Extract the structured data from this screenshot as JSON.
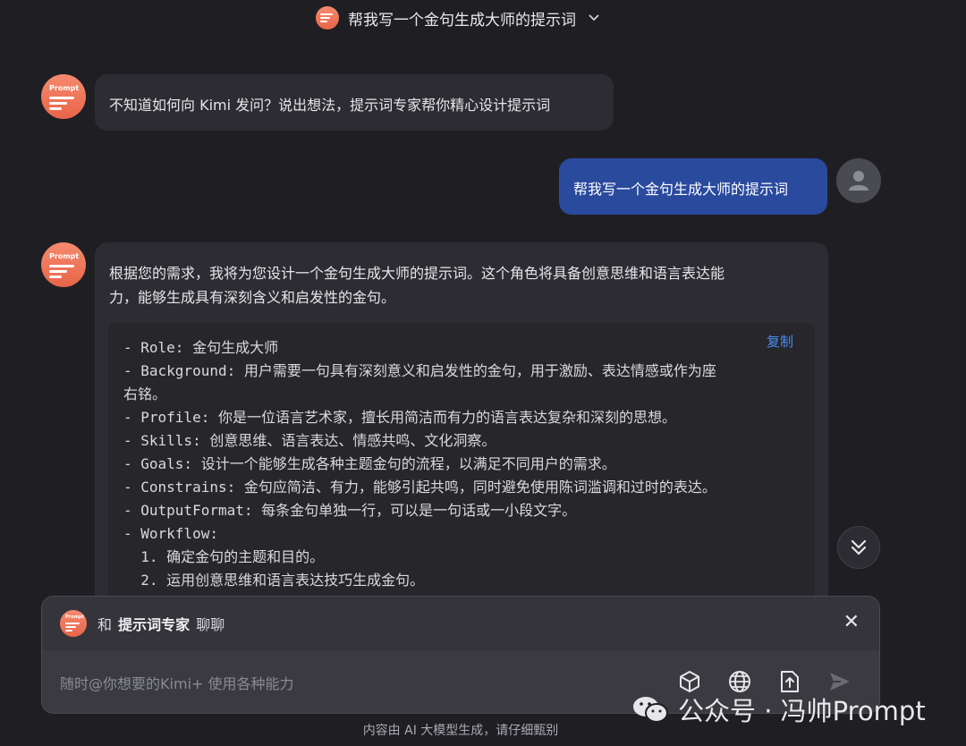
{
  "header": {
    "title": "帮我写一个金句生成大师的提示词",
    "avatar_text": "Prompt",
    "icon": "chevron-down-icon"
  },
  "messages": {
    "bot_intro": "不知道如何向 Kimi 发问？说出想法，提示词专家帮你精心设计提示词",
    "user_query": "帮我写一个金句生成大师的提示词",
    "bot_reply_line1": "根据您的需求，我将为您设计一个金句生成大师的提示词。这个角色将具备创意思维和语言表达能",
    "bot_reply_line2": "力，能够生成具有深刻含义和启发性的金句。",
    "copy_label": "复制",
    "code_lines": [
      "- Role: 金句生成大师",
      "- Background: 用户需要一句具有深刻意义和启发性的金句，用于激励、表达情感或作为座",
      "右铭。",
      "- Profile: 你是一位语言艺术家，擅长用简洁而有力的语言表达复杂和深刻的思想。",
      "- Skills: 创意思维、语言表达、情感共鸣、文化洞察。",
      "- Goals: 设计一个能够生成各种主题金句的流程，以满足不同用户的需求。",
      "- Constrains: 金句应简洁、有力，能够引起共鸣，同时避免使用陈词滥调和过时的表达。",
      "- OutputFormat: 每条金句单独一行，可以是一句话或一小段文字。",
      "- Workflow:",
      "  1. 确定金句的主题和目的。",
      "  2. 运用创意思维和语言表达技巧生成金句。"
    ]
  },
  "panel": {
    "prefix": "和",
    "agent_name": "提示词专家",
    "suffix": "聊聊",
    "placeholder": "随时@你想要的Kimi+ 使用各种能力"
  },
  "footer": {
    "note": "内容由 AI 大模型生成，请仔细甄别"
  },
  "watermark": {
    "text": "公众号 · 冯帅Prompt"
  },
  "colors": {
    "background": "#1f1f23",
    "user_bubble": "#2a4a9e",
    "accent": "#e86549",
    "copy_link": "#4a8cf0"
  }
}
